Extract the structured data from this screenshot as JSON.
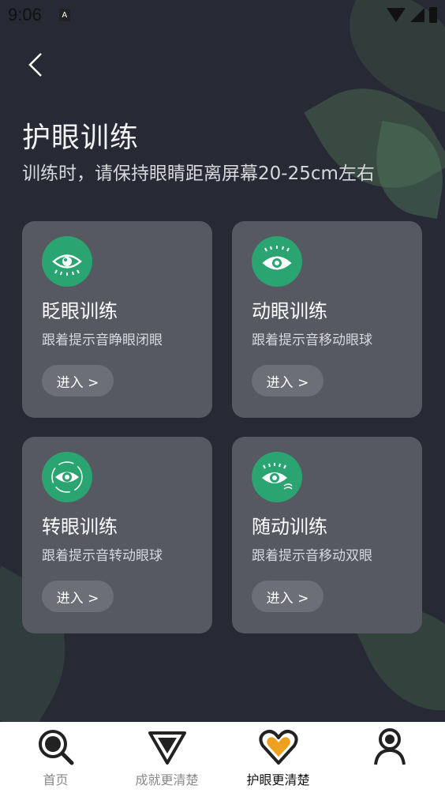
{
  "status_bar": {
    "time": "9:06",
    "notification_icon": "A"
  },
  "header": {
    "title": "护眼训练",
    "subtitle": "训练时，请保持眼睛距离屏幕20-25cm左右"
  },
  "cards": [
    {
      "title": "眨眼训练",
      "desc": "跟着提示音睁眼闭眼",
      "button": "进入 >",
      "icon": "blink-eye-icon"
    },
    {
      "title": "动眼训练",
      "desc": "跟着提示音移动眼球",
      "button": "进入 >",
      "icon": "move-eye-icon"
    },
    {
      "title": "转眼训练",
      "desc": "跟着提示音转动眼球",
      "button": "进入 >",
      "icon": "rotate-eye-icon"
    },
    {
      "title": "随动训练",
      "desc": "跟着提示音移动双眼",
      "button": "进入 >",
      "icon": "follow-eye-icon"
    }
  ],
  "bottom_nav": [
    {
      "label": "首页",
      "icon": "search-icon",
      "active": false
    },
    {
      "label": "成就更清楚",
      "icon": "diamond-icon",
      "active": false
    },
    {
      "label": "护眼更清楚",
      "icon": "heart-icon",
      "active": true
    },
    {
      "label": "",
      "icon": "user-icon",
      "active": false
    }
  ],
  "colors": {
    "background": "#272a35",
    "card": "#565862",
    "accent_green": "#2aa470",
    "accent_orange": "#f0a020"
  }
}
